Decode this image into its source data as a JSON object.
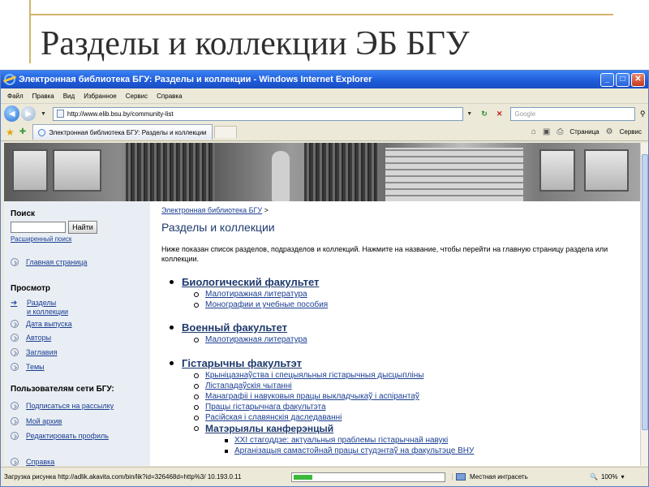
{
  "slide": {
    "title": "Разделы и коллекции ЭБ БГУ"
  },
  "browser": {
    "window_title": "Электронная библиотека БГУ: Разделы и коллекции - Windows Internet Explorer",
    "menu": [
      "Файл",
      "Правка",
      "Вид",
      "Избранное",
      "Сервис",
      "Справка"
    ],
    "url": "http://www.elib.bsu.by/community-list",
    "search_placeholder": "Google",
    "tab_title": "Электронная библиотека БГУ: Разделы и коллекции",
    "cmd_page": "Страница",
    "cmd_service": "Сервис"
  },
  "sidebar": {
    "search_label": "Поиск",
    "find_button": "Найти",
    "advanced_search": "Расширенный поиск",
    "home": "Главная страница",
    "browse_heading": "Просмотр",
    "browse_items": [
      {
        "label_line1": "Разделы",
        "label_line2": "и коллекции"
      },
      {
        "label_line1": "Дата выпуска"
      },
      {
        "label_line1": "Авторы"
      },
      {
        "label_line1": "Заглавия"
      },
      {
        "label_line1": "Темы"
      }
    ],
    "users_heading": "Пользователям сети БГУ:",
    "user_items": [
      "Подписаться на рассылку",
      "Мой архив",
      "Редактировать профиль"
    ],
    "help": "Справка"
  },
  "main": {
    "breadcrumb_link": "Электронная библиотека БГУ",
    "breadcrumb_sep": ">",
    "heading": "Разделы и коллекции",
    "intro": "Ниже показан список разделов, подразделов и коллекций. Нажмите на название, чтобы перейти на главную страницу раздела или коллекции.",
    "faculties": [
      {
        "name": "Биологический факультет",
        "collections": [
          "Малотиражная литература",
          "Монографии и учебные пособия"
        ]
      },
      {
        "name": "Военный факультет",
        "collections": [
          "Малотиражная литература"
        ]
      },
      {
        "name": "Гістарычны факультэт",
        "collections": [
          "Крыніцазнаўства і спецыяльныя гістарычныя дысцыпліны",
          "Лістападаўскія чытанні",
          "Манаграфіі і навуковыя працы выкладчыкаў і аспірантаў",
          "Працы гістарычнага факультэта",
          "Расійская і славянскія даследаванні"
        ],
        "group": {
          "name": "Матэрыялы канферэнцый",
          "items": [
            "XXI стагоддзе: актуальныя праблемы гістарычнай навукі",
            "Арганізацыя самастойнай працы студэнтаў на факультэце ВНУ"
          ]
        }
      }
    ]
  },
  "status": {
    "loading_text": "Загрузка рисунка http://adlik.akavita.com/bin/lik?id=326468d=http%3/ 10.193.0.11",
    "progress": 0.12,
    "zone": "Местная интрасеть",
    "zoom": "100%"
  }
}
